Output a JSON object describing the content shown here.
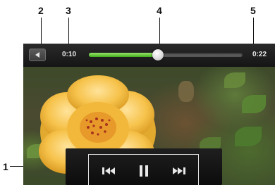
{
  "callouts": {
    "c1": "1",
    "c2": "2",
    "c3": "3",
    "c4": "4",
    "c5": "5"
  },
  "player": {
    "elapsed": "0:10",
    "duration": "0:22",
    "progress": 0.45,
    "progress_color": "#4cc22a",
    "controls": [
      "previous-icon",
      "pause-icon",
      "next-icon"
    ],
    "back_icon": "back-arrow-icon"
  }
}
